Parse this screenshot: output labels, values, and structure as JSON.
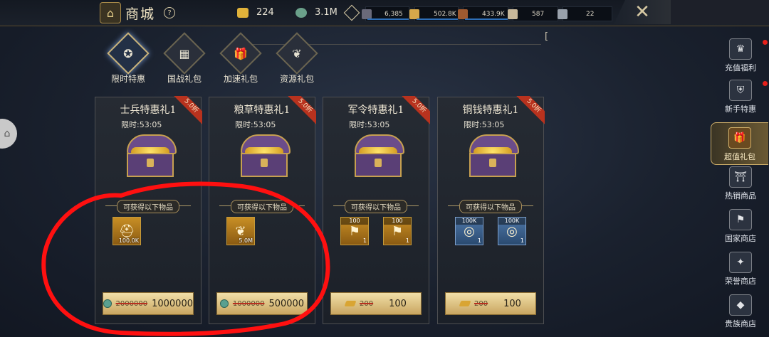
{
  "topbar": {
    "title": "商城",
    "help_icon": "?",
    "resources": [
      {
        "icon": "gold-bar-icon",
        "value": "224"
      },
      {
        "icon": "copper-coin-icon",
        "value": "3.1M"
      }
    ],
    "troops": [
      {
        "icon": "soldier-icon",
        "value": "6,385"
      },
      {
        "icon": "grain-icon",
        "value": "502.8K"
      },
      {
        "icon": "wood-icon",
        "value": "433.9K"
      },
      {
        "icon": "stone-icon",
        "value": "587"
      },
      {
        "icon": "iron-icon",
        "value": "22"
      }
    ],
    "close_icon": "✕"
  },
  "bracket_text": "[",
  "tabs": [
    {
      "label": "限时特惠",
      "icon": "✪",
      "active": true
    },
    {
      "label": "国战礼包",
      "icon": "▦",
      "active": false
    },
    {
      "label": "加速礼包",
      "icon": "🎁",
      "active": false
    },
    {
      "label": "资源礼包",
      "icon": "❦",
      "active": false
    }
  ],
  "cards": [
    {
      "title": "士兵特惠礼1",
      "badge": "5.0折",
      "timer": "限时:53:05",
      "get_label": "可获得以下物品",
      "items": [
        {
          "amount": "100.0K",
          "glyph": "⛑"
        }
      ],
      "old_price": "2000000",
      "new_price": "1000000"
    },
    {
      "title": "粮草特惠礼1",
      "badge": "5.0折",
      "timer": "限时:53:05",
      "get_label": "可获得以下物品",
      "items": [
        {
          "amount": "5.0M",
          "glyph": "❦"
        }
      ],
      "old_price": "1000000",
      "new_price": "500000"
    },
    {
      "title": "军令特惠礼1",
      "badge": "5.0折",
      "timer": "限时:53:05",
      "get_label": "可获得以下物品",
      "items": [
        {
          "top": "100",
          "count": "1",
          "glyph": "⚑"
        },
        {
          "top": "100",
          "count": "1",
          "glyph": "⚑"
        }
      ],
      "old_price": "200",
      "new_price": "100"
    },
    {
      "title": "铜钱特惠礼1",
      "badge": "5.0折",
      "timer": "限时:53:05",
      "get_label": "可获得以下物品",
      "items": [
        {
          "top": "100K",
          "count": "1",
          "glyph": "◎"
        },
        {
          "top": "100K",
          "count": "1",
          "glyph": "◎"
        }
      ],
      "old_price": "200",
      "new_price": "100"
    }
  ],
  "sidebar": [
    {
      "label": "充值福利",
      "icon": "♛",
      "dot": true
    },
    {
      "label": "新手特惠",
      "icon": "⛨",
      "dot": true
    },
    {
      "label": "超值礼包",
      "icon": "🎁",
      "active": true
    },
    {
      "label": "热销商品",
      "icon": "⛩"
    },
    {
      "label": "国家商店",
      "icon": "⚑"
    },
    {
      "label": "荣誉商店",
      "icon": "✦"
    },
    {
      "label": "贵族商店",
      "icon": "◆"
    }
  ],
  "colors": {
    "accent_gold": "#c9a661",
    "discount_red": "#b8321e",
    "annotation_red": "#ff1010"
  }
}
